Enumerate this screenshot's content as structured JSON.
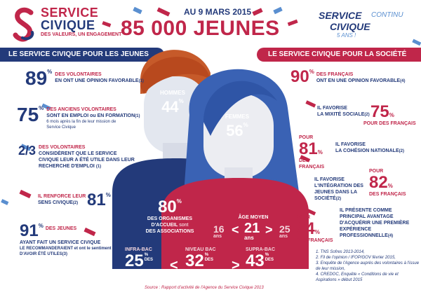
{
  "header": {
    "logo_line1": "SERVICE",
    "logo_line2": "CIVIQUE",
    "logo_tagline": "DES VALEURS, UN ENGAGEMENT",
    "date": "AU 9 MARS 2015",
    "title": "85 000 JEUNES",
    "right_logo_line1": "SERVICE",
    "right_logo_continu": "CONTINU",
    "right_logo_line2": "CIVIQUE",
    "right_logo_years": "5 ANS !"
  },
  "banners": {
    "left": "LE SERVICE CIVIQUE POUR LES JEUNES",
    "right": "LE SERVICE CIVIQUE POUR LA SOCIÉTÉ"
  },
  "left_stats": [
    {
      "value": "89",
      "unit": "%",
      "text1": "DES VOLONTAIRES",
      "text2": "EN ONT UNE OPINION FAVORABLE",
      "note": "(1)"
    },
    {
      "value": "75",
      "unit": "%",
      "text1": "DES ANCIENS VOLONTAIRES",
      "text2": "SONT EN EMPLOI ou EN FORMATION",
      "note": "(1)",
      "sub": "6 mois après la fin de leur mission de Service Civique"
    },
    {
      "value": "2/3",
      "text1": "DES VOLONTAIRES",
      "text2": "CONSIDÈRENT QUE LE SERVICE CIVIQUE LEUR A ÉTÉ UTILE DANS LEUR RECHERCHE D'EMPLOI",
      "note": "(1)"
    },
    {
      "value": "81",
      "unit": "%",
      "text1": "IL RENFORCE LEUR",
      "text2": "SENS CIVIQUE",
      "note": "(2)"
    },
    {
      "value": "91",
      "unit": "%",
      "text1": "DES JEUNES",
      "text2": "AYANT FAIT UN SERVICE CIVIQUE",
      "text3": "LE RECOMMANDERAIENT et ont le sentiment D'AVOIR ÉTÉ UTILES",
      "note": "(3)"
    }
  ],
  "right_stats": [
    {
      "value": "90",
      "unit": "%",
      "text1": "DES FRANÇAIS",
      "text2": "ONT EN UNE OPINION FAVORABLE",
      "note": "(4)"
    },
    {
      "value": "75",
      "unit": "%",
      "pre1": "IL FAVORISE",
      "pre2": "LA MIXITÉ SOCIALE",
      "note": "(2)",
      "post": "POUR DES FRANÇAIS"
    },
    {
      "value": "81",
      "unit": "%",
      "pre": "POUR",
      "post": "DES FRANÇAIS",
      "text1": "IL FAVORISE",
      "text2": "LA COHÉSION NATIONALE",
      "note": "(2)"
    },
    {
      "value": "82",
      "unit": "%",
      "text1": "IL FAVORISE L'INTÉGRATION DES JEUNES DANS LA SOCIÉTÉ",
      "note": "(2)",
      "pre": "POUR",
      "post": "DES FRANÇAIS"
    },
    {
      "value": "94",
      "unit": "%",
      "pre": "POUR",
      "post": "DES FRANÇAIS",
      "text1": "IL PRÉSENTE COMME PRINCIPAL AVANTAGE D'ACQUÉRIR UNE PREMIÈRE EXPÉRIENCE PROFESSIONNELLE",
      "note": "(4)"
    }
  ],
  "gender": {
    "men_label": "HOMMES",
    "men_value": "44",
    "unit": "%",
    "women_label": "FEMMES",
    "women_value": "56"
  },
  "organisations": {
    "value": "80",
    "unit": "%",
    "text1": "DES ORGANISMES",
    "text2": "D'ACCUEIL",
    "text3": "sont",
    "text4": "DES ASSOCIATIONS"
  },
  "age": {
    "label": "ÂGE MOYEN",
    "min": "16",
    "avg": "21",
    "max": "25",
    "unit": "ans"
  },
  "education": [
    {
      "label": "INFRA-BAC",
      "value": "25",
      "unit": "%",
      "text1": "DES",
      "text2": "VOLONTAIRES"
    },
    {
      "label": "NIVEAU BAC",
      "value": "32",
      "unit": "%",
      "text1": "DES",
      "text2": "VOLONTAIRES"
    },
    {
      "label": "SUPRA-BAC",
      "value": "43",
      "unit": "%",
      "text1": "DES",
      "text2": "VOLONTAIRES"
    }
  ],
  "comparators": {
    "lt": "<",
    "gt": ">"
  },
  "sources": [
    "1. TNS Sofres 2013-2014,",
    "2. Fil de l'opinion / IFOP/GOV février 2015,",
    "3. Enquête de l'Agence auprès des volontaires à l'issue de leur mission,",
    "4. CREDOC, Enquête « Conditions de vie et Aspirations » début 2015"
  ],
  "source_line": "Source : Rapport d'activité de l'Agence du Service Civique 2013",
  "colors": {
    "navy": "#233a7a",
    "crimson": "#c0264a",
    "blue": "#5a8fd0"
  }
}
